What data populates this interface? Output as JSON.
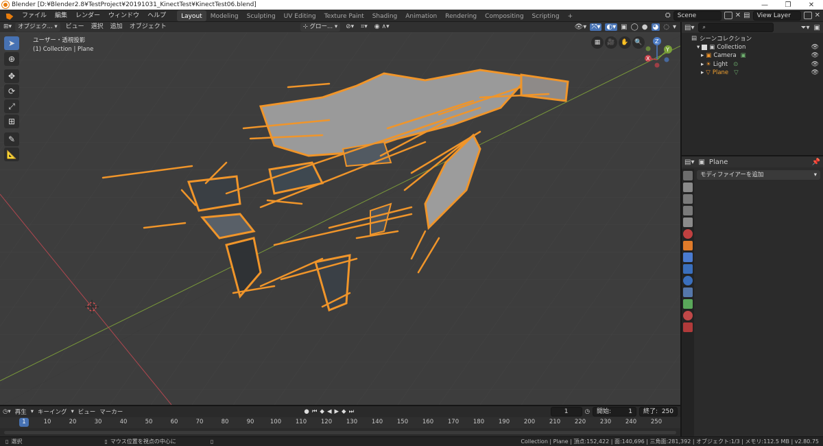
{
  "titlebar": {
    "title": "Blender [D:¥Blender2.8¥TestProject¥20191031_KinectTest¥KinectTest06.blend]",
    "minimize": "—",
    "maximize": "❐",
    "close": "✕"
  },
  "menubar": {
    "menus": [
      "ファイル",
      "編集",
      "レンダー",
      "ウィンドウ",
      "ヘルプ"
    ],
    "workspaces": [
      "Layout",
      "Modeling",
      "Sculpting",
      "UV Editing",
      "Texture Paint",
      "Shading",
      "Animation",
      "Rendering",
      "Compositing",
      "Scripting"
    ],
    "active_workspace": "Layout",
    "add_workspace": "+",
    "scene": "Scene",
    "view_layer": "View Layer"
  },
  "viewport_header": {
    "mode": "オブジェク...",
    "menus": [
      "ビュー",
      "選択",
      "追加",
      "オブジェクト"
    ],
    "transform_orientation": "グロー...",
    "info_line1": "ユーザー・透視投影",
    "info_line2": "(1) Collection | Plane"
  },
  "gizmo": {
    "x": "X",
    "y": "Y",
    "z": "Z"
  },
  "outliner": {
    "scene_collection": "シーンコレクション",
    "items": [
      {
        "name": "Collection",
        "color": "#cfcfcf"
      },
      {
        "name": "Camera",
        "color": "#cfcfcf"
      },
      {
        "name": "Light",
        "color": "#cfcfcf"
      },
      {
        "name": "Plane",
        "color": "#f0a030"
      }
    ]
  },
  "properties": {
    "object_name": "Plane",
    "add_modifier": "モディファイアーを追加"
  },
  "timeline": {
    "menus": [
      "再生",
      "キーイング",
      "ビュー",
      "マーカー"
    ],
    "current_frame": "1",
    "start_label": "開始:",
    "start": "1",
    "end_label": "終了:",
    "end": "250",
    "ticks": [
      "10",
      "20",
      "30",
      "40",
      "50",
      "60",
      "70",
      "80",
      "90",
      "100",
      "110",
      "120",
      "130",
      "140",
      "150",
      "160",
      "170",
      "180",
      "190",
      "200",
      "210",
      "220",
      "230",
      "240",
      "250"
    ],
    "frame_marker": "1"
  },
  "status": {
    "select": "選択",
    "center": "マウス位置を視点の中心に",
    "stats": "Collection | Plane | 頂点:152,422 | 面:140,696 | 三角面:281,392 | オブジェクト:1/3 | メモリ:112.5 MB | v2.80.75"
  },
  "colors": {
    "accent": "#4772b3",
    "selection": "#f0952a",
    "viewport_bg": "#3d3d3d"
  }
}
